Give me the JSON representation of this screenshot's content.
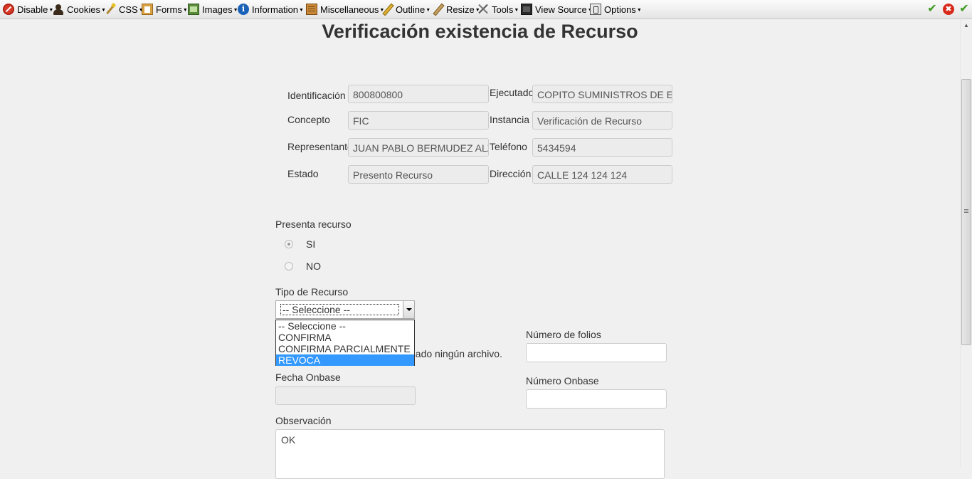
{
  "toolbar": {
    "items": [
      {
        "label": "Disable",
        "icon": "disable-icon"
      },
      {
        "label": "Cookies",
        "icon": "cookies-icon"
      },
      {
        "label": "CSS",
        "icon": "css-icon"
      },
      {
        "label": "Forms",
        "icon": "forms-icon"
      },
      {
        "label": "Images",
        "icon": "images-icon"
      },
      {
        "label": "Information",
        "icon": "information-icon"
      },
      {
        "label": "Miscellaneous",
        "icon": "miscellaneous-icon"
      },
      {
        "label": "Outline",
        "icon": "outline-icon"
      },
      {
        "label": "Resize",
        "icon": "resize-icon"
      },
      {
        "label": "Tools",
        "icon": "tools-icon"
      },
      {
        "label": "View Source",
        "icon": "view-source-icon"
      },
      {
        "label": "Options",
        "icon": "options-icon"
      }
    ],
    "info_glyph": "i",
    "check_glyph": "✔",
    "close_glyph": "✖"
  },
  "page": {
    "title": "Verificación existencia de Recurso"
  },
  "info": {
    "identificacion": {
      "label": "Identificación",
      "value": "800800800"
    },
    "ejecutado": {
      "label": "Ejecutado",
      "value": "COPITO SUMINISTROS DE EQ"
    },
    "concepto": {
      "label": "Concepto",
      "value": "FIC"
    },
    "instancia": {
      "label": "Instancia",
      "value": "Verificación de Recurso"
    },
    "representante": {
      "label": "Representante",
      "value": "JUAN PABLO BERMUDEZ ALZ"
    },
    "telefono": {
      "label": "Teléfono",
      "value": "5434594"
    },
    "estado": {
      "label": "Estado",
      "value": "Presento Recurso"
    },
    "direccion": {
      "label": "Dirección",
      "value": "CALLE 124 124 124"
    }
  },
  "form": {
    "presenta_recurso": {
      "label": "Presenta recurso",
      "options": [
        {
          "label": "SI",
          "checked": true
        },
        {
          "label": "NO",
          "checked": false
        }
      ]
    },
    "tipo_recurso": {
      "label": "Tipo de Recurso",
      "selected": "-- Seleccione --",
      "options": [
        "-- Seleccione --",
        "CONFIRMA",
        "CONFIRMA PARCIALMENTE",
        "REVOCA"
      ],
      "highlighted": "REVOCA"
    },
    "file_status": "nado ningún archivo.",
    "numero_folios": {
      "label": "Número de folios",
      "value": ""
    },
    "fecha_onbase": {
      "label": "Fecha Onbase",
      "value": ""
    },
    "numero_onbase": {
      "label": "Número Onbase",
      "value": ""
    },
    "observacion": {
      "label": "Observación",
      "value": "OK"
    }
  },
  "colors": {
    "toolbar_bg": "#ececec",
    "page_bg": "#f0f0f0",
    "highlight": "#3399ff"
  }
}
